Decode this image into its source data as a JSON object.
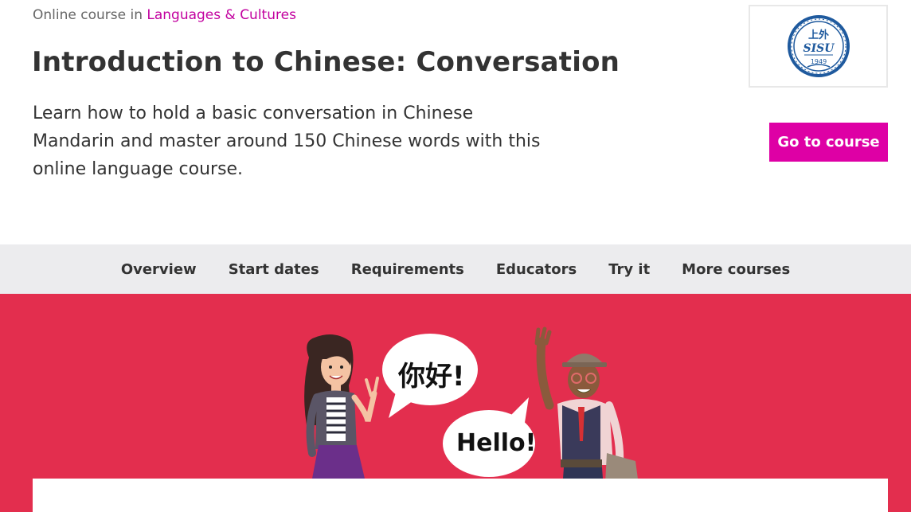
{
  "breadcrumb": {
    "prefix": "Online course in",
    "category": "Languages & Cultures"
  },
  "course": {
    "title": "Introduction to Chinese: Conversation",
    "description": "Learn how to hold a basic conversation in Chinese Mandarin and master around 150 Chinese words with this online language course."
  },
  "logo": {
    "icon": "sisu-university-seal",
    "year": "1949",
    "name": "SISU",
    "chinese": "上外"
  },
  "cta": {
    "label": "Go to course"
  },
  "tabs": [
    {
      "label": "Overview"
    },
    {
      "label": "Start dates"
    },
    {
      "label": "Requirements"
    },
    {
      "label": "Educators"
    },
    {
      "label": "Try it"
    },
    {
      "label": "More courses"
    }
  ],
  "hero": {
    "bubble_chinese": "你好!",
    "bubble_english": "Hello!"
  },
  "colors": {
    "accent": "#de00a5",
    "link": "#c2009f",
    "hero_bg": "#e32e4e",
    "tabs_bg": "#ececee",
    "logo_blue": "#1f5a9e"
  }
}
